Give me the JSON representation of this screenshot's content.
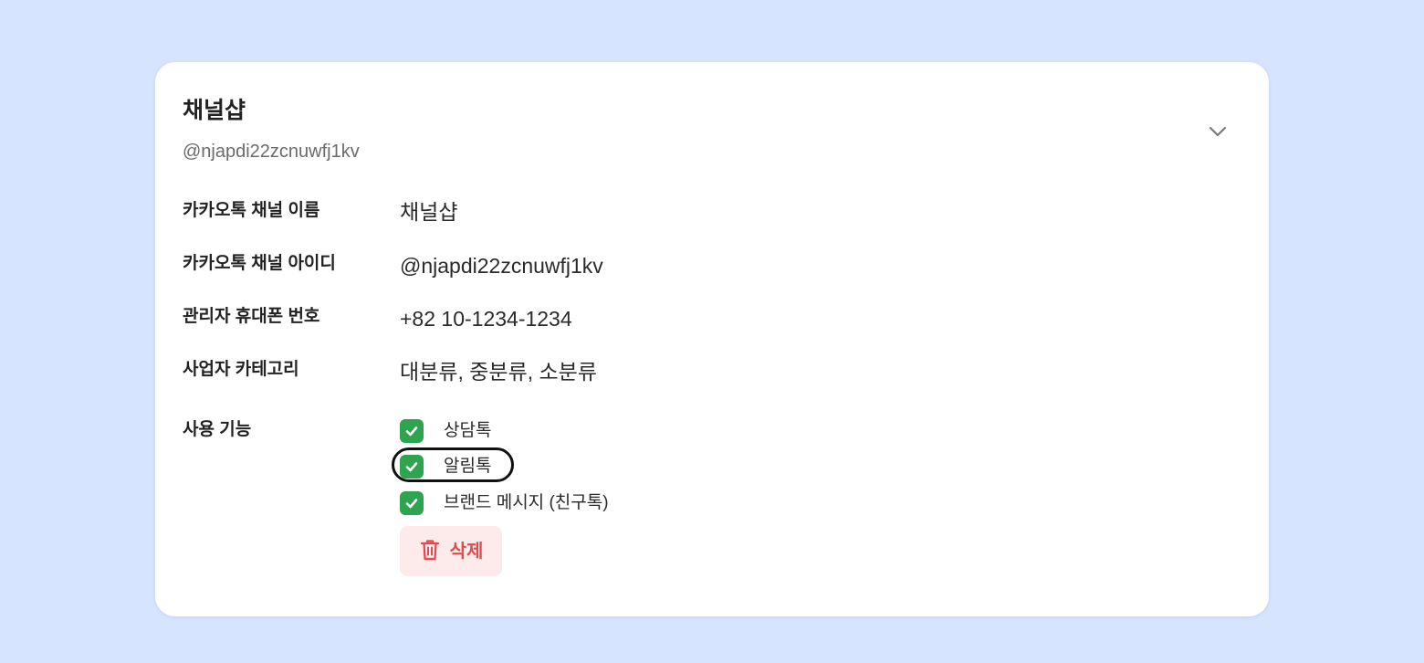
{
  "card": {
    "title": "채널샵",
    "subtitle": "@njapdi22zcnuwfj1kv",
    "collapse_icon": "chevron-down-icon"
  },
  "fields": [
    {
      "label": "카카오톡 채널 이름",
      "value": "채널샵"
    },
    {
      "label": "카카오톡 채널 아이디",
      "value": "@njapdi22zcnuwfj1kv"
    },
    {
      "label": "관리자 휴대폰 번호",
      "value": "+82 10-1234-1234"
    },
    {
      "label": "사업자 카테고리",
      "value": "대분류, 중분류, 소분류"
    }
  ],
  "features": {
    "label": "사용 기능",
    "items": [
      {
        "label": "상담톡",
        "checked": true,
        "focused": false
      },
      {
        "label": "알림톡",
        "checked": true,
        "focused": true
      },
      {
        "label": "브랜드 메시지 (친구톡)",
        "checked": true,
        "focused": false
      }
    ]
  },
  "delete_button": {
    "label": "삭제",
    "icon": "trash-icon"
  },
  "colors": {
    "background": "#d6e4ff",
    "card": "#ffffff",
    "checkbox": "#2ea44f",
    "danger": "#e5484d",
    "danger_bg": "#fdeaea"
  }
}
